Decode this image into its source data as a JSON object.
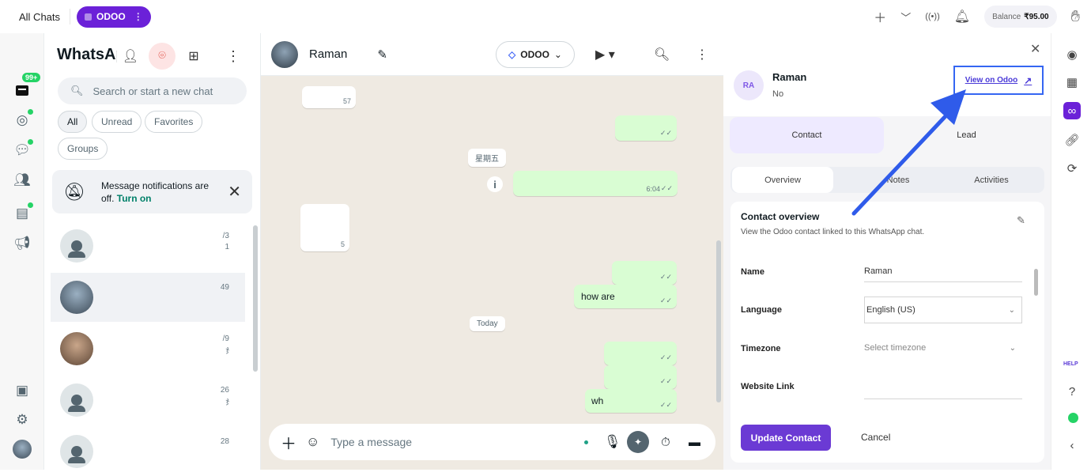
{
  "topbar": {
    "all_chats": "All Chats",
    "workspace_tab": "ODOO",
    "balance_label": "Balance",
    "balance_value": "₹95.00"
  },
  "left_rail": {
    "badge": "99+"
  },
  "chat_list": {
    "title": "WhatsApp",
    "search_placeholder": "Search or start a new chat",
    "filters": [
      "All",
      "Unread",
      "Favorites",
      "Groups"
    ],
    "notification": {
      "text": "Message notifications are off.",
      "action": "Turn on"
    },
    "rows": [
      {
        "time": "/3",
        "preview": "1"
      },
      {
        "time": "49",
        "preview": ""
      },
      {
        "time": "/9",
        "preview": "ჯ"
      },
      {
        "time": "26",
        "preview": "ჯ"
      },
      {
        "time": "28",
        "preview": ""
      }
    ]
  },
  "conversation": {
    "contact_name": "Raman",
    "tag_label": "ODOO",
    "day_label_1": "星期五",
    "day_label_2": "Today",
    "messages": [
      {
        "time": "57"
      },
      {
        "time": "6:04"
      },
      {
        "time": "5"
      },
      {
        "text": "how are"
      },
      {
        "text": "wh"
      }
    ],
    "composer_placeholder": "Type a message"
  },
  "contact_panel": {
    "initials": "RA",
    "name": "Raman",
    "sub": "No",
    "view_on_odoo": "View on Odoo",
    "segments": [
      "Contact",
      "Lead"
    ],
    "tabs": [
      "Overview",
      "Notes",
      "Activities"
    ],
    "card_title": "Contact overview",
    "card_subtitle": "View the Odoo contact linked to this WhatsApp chat.",
    "fields": [
      {
        "label": "Name",
        "value": "Raman"
      },
      {
        "label": "Language",
        "value": "English (US)"
      },
      {
        "label": "Timezone",
        "value": "Select timezone"
      },
      {
        "label": "Website Link",
        "value": ""
      }
    ],
    "update_button": "Update Contact",
    "cancel_button": "Cancel"
  },
  "right_rail": {
    "help": "HELP"
  },
  "colors": {
    "brand_purple": "#6b21d8",
    "whatsapp_green": "#25d366",
    "annotation_blue": "#2f5bea"
  }
}
